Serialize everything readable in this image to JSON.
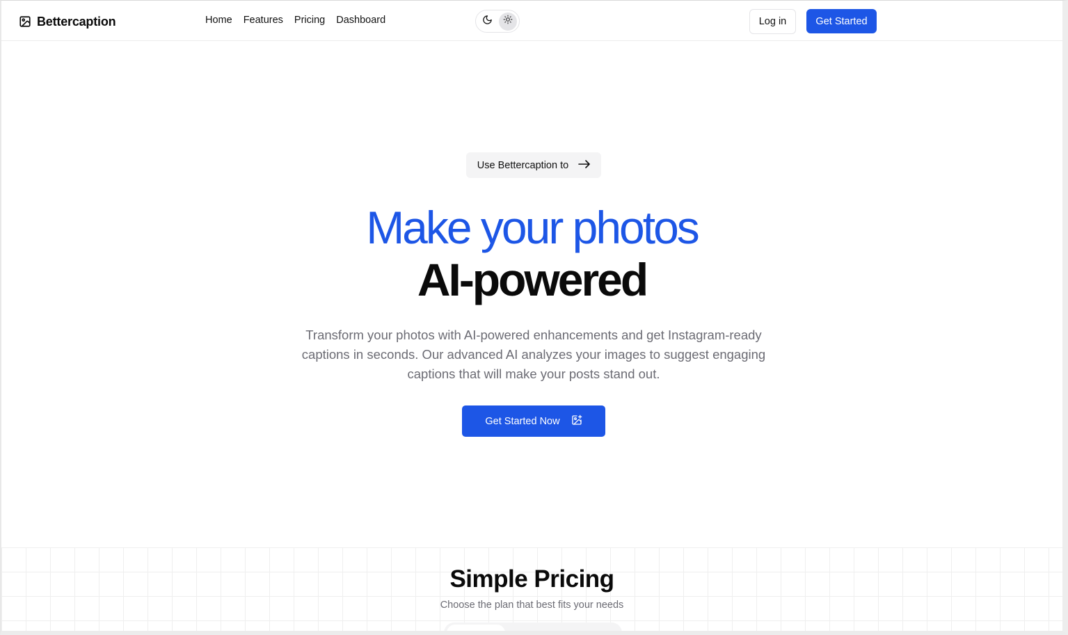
{
  "header": {
    "brand": "Bettercaption",
    "nav": [
      "Home",
      "Features",
      "Pricing",
      "Dashboard"
    ],
    "login_label": "Log in",
    "get_started_label": "Get Started"
  },
  "hero": {
    "pill_label": "Use Bettercaption to",
    "headline_line1": "Make your photos",
    "headline_line2": "AI-powered",
    "subtitle": "Transform your photos with AI-powered enhancements and get Instagram-ready captions in seconds. Our advanced AI analyzes your images to suggest engaging captions that will make your posts stand out.",
    "cta_label": "Get Started Now"
  },
  "pricing": {
    "title": "Simple Pricing",
    "subtitle": "Choose the plan that best fits your needs"
  },
  "colors": {
    "accent": "#1d56e6",
    "muted_text": "#6b6b73"
  },
  "icons": {
    "brand": "image-icon",
    "theme_dark": "moon-icon",
    "theme_light": "sun-icon",
    "pill": "arrow-right-icon",
    "cta": "image-plus-icon"
  }
}
